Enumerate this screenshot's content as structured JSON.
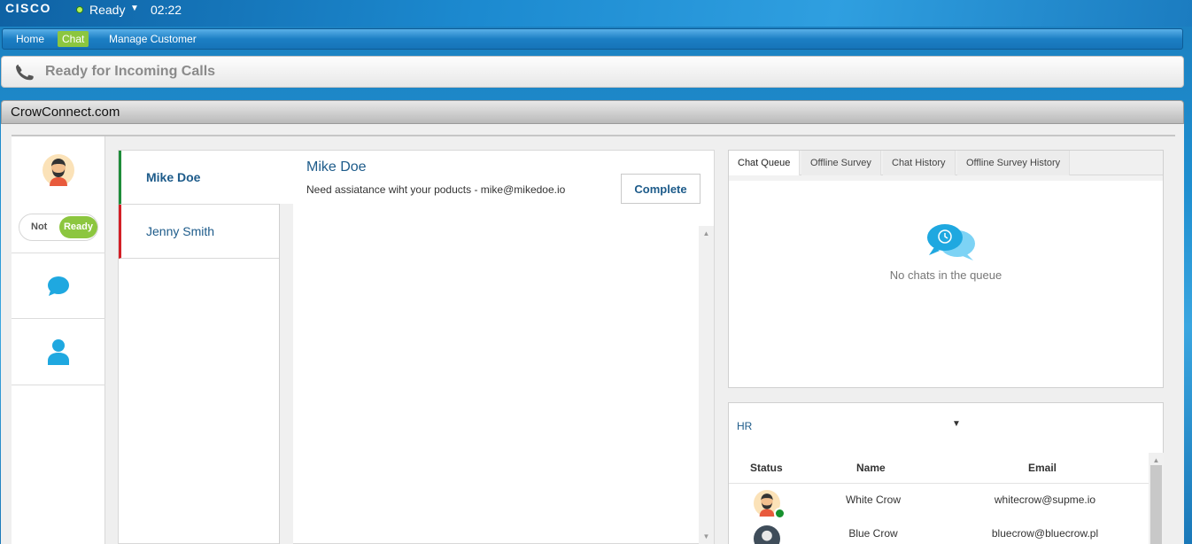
{
  "topbar": {
    "brand": "CISCO",
    "agent_state": "Ready",
    "timer": "02:22",
    "status_color": "#b6f25a"
  },
  "nav": {
    "items": [
      {
        "label": "Home",
        "active": false
      },
      {
        "label": "Chat",
        "active": true
      },
      {
        "label": "Manage Customer",
        "active": false
      }
    ],
    "active_color": "#8cc63f"
  },
  "banner": {
    "text": "Ready for Incoming Calls",
    "icon": "phone-icon"
  },
  "panel": {
    "title": "CrowConnect.com"
  },
  "rail": {
    "toggle_off": "Not",
    "toggle_on": "Ready",
    "icons": [
      "agent-avatar-icon",
      "chat-bubble-icon",
      "user-icon"
    ]
  },
  "conversations": [
    {
      "name": "Mike Doe",
      "status_color": "#1e8c3a",
      "active": true
    },
    {
      "name": "Jenny Smith",
      "status_color": "#d31f26",
      "active": false
    }
  ],
  "chat": {
    "customer_name": "Mike Doe",
    "topic": "Need assiatance wiht your poducts - mike@mikedoe.io",
    "complete_label": "Complete"
  },
  "queue": {
    "tabs": [
      "Chat Queue",
      "Offline Survey",
      "Chat History",
      "Offline Survey History"
    ],
    "active_tab": "Chat Queue",
    "empty_message": "No chats in the queue",
    "icon": "chat-queue-icon"
  },
  "contacts": {
    "group": "HR",
    "columns": [
      "Status",
      "Name",
      "Email"
    ],
    "rows": [
      {
        "name": "White Crow",
        "email": "whitecrow@supme.io",
        "status": "online"
      },
      {
        "name": "Blue Crow",
        "email": "bluecrow@bluecrow.pl",
        "status": "unknown"
      }
    ],
    "online_color": "#16912e"
  }
}
